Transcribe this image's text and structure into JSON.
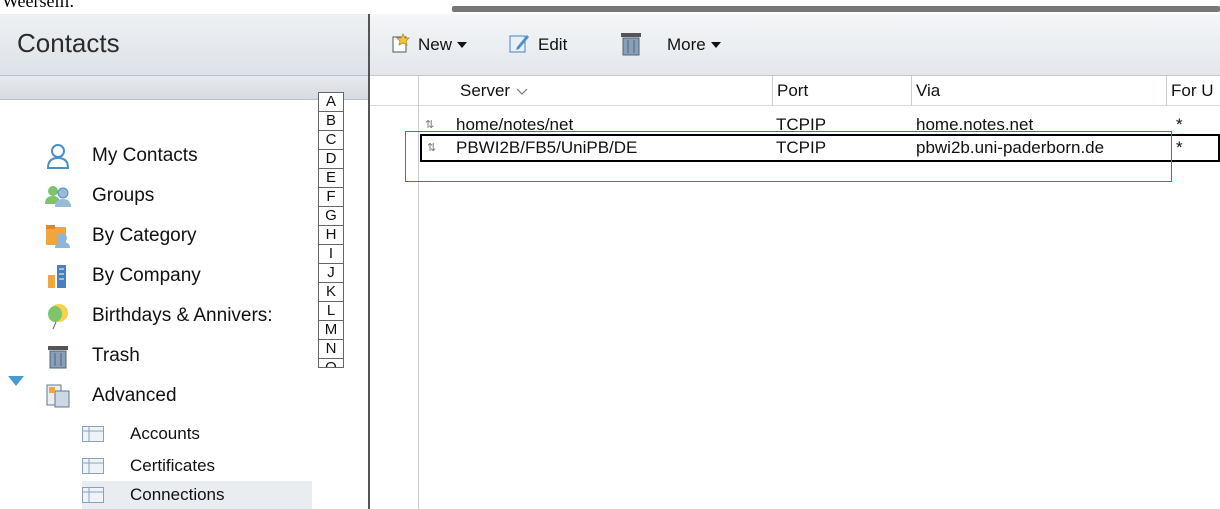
{
  "left_pane": {
    "title": "Contacts",
    "nav": [
      {
        "label": "My Contacts",
        "icon": "person-icon"
      },
      {
        "label": "Groups",
        "icon": "group-icon"
      },
      {
        "label": "By Category",
        "icon": "category-icon"
      },
      {
        "label": "By Company",
        "icon": "company-icon"
      },
      {
        "label": "Birthdays & Annivers:",
        "icon": "balloon-icon"
      },
      {
        "label": "Trash",
        "icon": "trash-icon"
      },
      {
        "label": "Advanced",
        "icon": "advanced-icon"
      }
    ],
    "subnav": [
      {
        "label": "Accounts",
        "icon": "table-icon"
      },
      {
        "label": "Certificates",
        "icon": "table-icon"
      },
      {
        "label": "Connections",
        "icon": "table-icon",
        "selected": true
      }
    ],
    "alpha_index": [
      "A",
      "B",
      "C",
      "D",
      "E",
      "F",
      "G",
      "H",
      "I",
      "J",
      "K",
      "L",
      "M",
      "N",
      "O"
    ]
  },
  "toolbar": {
    "new_label": "New",
    "edit_label": "Edit",
    "more_label": "More"
  },
  "table": {
    "columns": [
      {
        "label": "Server",
        "sort": "chevron-down-icon"
      },
      {
        "label": "Port"
      },
      {
        "label": "Via"
      },
      {
        "label": "For U"
      }
    ],
    "rows": [
      {
        "server": "home/notes/net",
        "port": "TCPIP",
        "via": "home.notes.net",
        "for": "*"
      },
      {
        "server": "PBWI2B/FB5/UniPB/DE",
        "port": "TCPIP",
        "via": "pbwi2b.uni-paderborn.de",
        "for": "*",
        "selected": true
      }
    ]
  },
  "top_cut_text": "Weerseili.",
  "colors": {
    "highlight_box": "#e23a3a",
    "twisty": "#4a9bd1"
  }
}
